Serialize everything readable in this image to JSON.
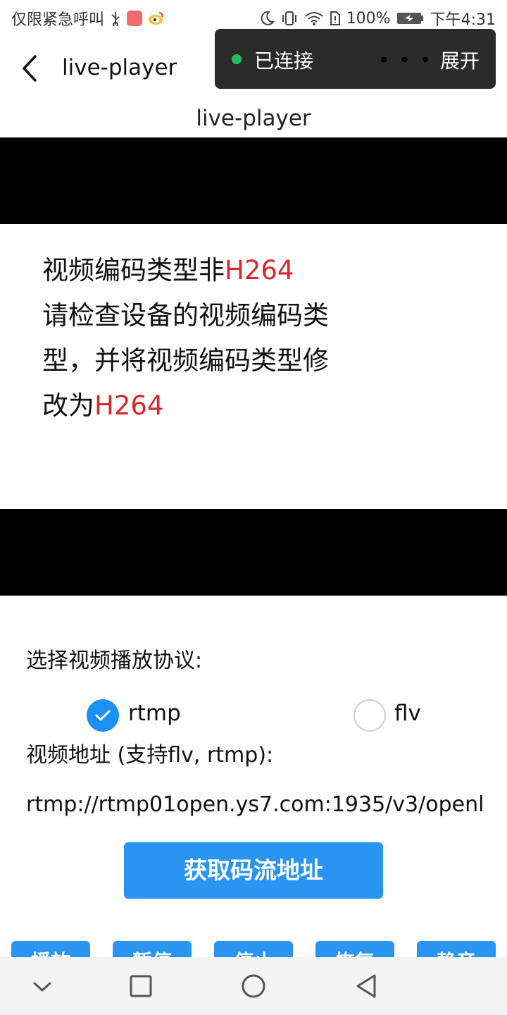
{
  "status_bar": {
    "carrier_text": "仅限紧急呼叫",
    "battery_percent": "100%",
    "time": "下午4:31",
    "icons": [
      "usb-icon",
      "app-notification-icon",
      "weibo-icon",
      "moon-icon",
      "vibrate-icon",
      "wifi-icon",
      "sim-icon",
      "battery-icon"
    ]
  },
  "nav": {
    "title": "live-player",
    "back_icon": "chevron-left-icon"
  },
  "toast": {
    "status": "已连接",
    "more": "• • •",
    "expand": "展开",
    "status_color": "#1ec15f"
  },
  "page": {
    "title": "live-player"
  },
  "video": {
    "message_part1": "视频编码类型非",
    "message_code1": "H264",
    "message_part2": "请检查设备的视频编码类型，并将视频编码类型修改为",
    "message_code2": "H264"
  },
  "protocol": {
    "label": "选择视频播放协议:",
    "options": [
      {
        "label": "rtmp",
        "checked": true
      },
      {
        "label": "flv",
        "checked": false
      }
    ]
  },
  "url": {
    "label": "视频地址 (支持flv, rtmp):",
    "value": "rtmp://rtmp01open.ys7.com:1935/v3/openl"
  },
  "actions": {
    "get_stream_label": "获取码流地址",
    "bottom_buttons": [
      "播放",
      "暂停",
      "停止",
      "恢复",
      "静音"
    ]
  },
  "colors": {
    "accent": "#2a95f0",
    "highlight_red": "#d8262b"
  }
}
